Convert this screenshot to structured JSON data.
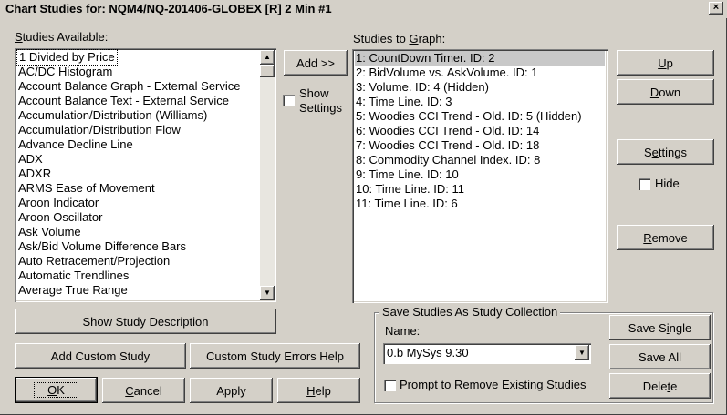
{
  "window": {
    "title": "Chart Studies for: NQM4/NQ-201406-GLOBEX [R]  2 Min  #1",
    "close_label": "×"
  },
  "available": {
    "label_prefix": "",
    "label_u": "S",
    "label_rest": "tudies Available:",
    "items": [
      "1 Divided by Price",
      "AC/DC Histogram",
      "Account Balance Graph - External Service",
      "Account Balance Text - External Service",
      "Accumulation/Distribution (Williams)",
      "Accumulation/Distribution Flow",
      "Advance Decline Line",
      "ADX",
      "ADXR",
      "ARMS Ease of Movement",
      "Aroon Indicator",
      "Aroon Oscillator",
      "Ask Volume",
      "Ask/Bid Volume Difference Bars",
      "Auto Retracement/Projection",
      "Automatic Trendlines",
      "Average True Range"
    ],
    "selected_index": 0
  },
  "add": {
    "label": "Add >>"
  },
  "show_settings": {
    "line1": "Show",
    "line2": "Settings",
    "checked": false
  },
  "to_graph": {
    "label_prefix": "Studies to ",
    "label_u": "G",
    "label_rest": "raph:",
    "items": [
      "1: CountDown Timer. ID: 2",
      "2: BidVolume vs. AskVolume. ID: 1",
      "3: Volume. ID: 4 (Hidden)",
      "4: Time Line. ID: 3",
      "5: Woodies CCI Trend - Old. ID: 5 (Hidden)",
      "6: Woodies CCI Trend - Old. ID: 14",
      "7: Woodies CCI Trend - Old. ID: 18",
      "8: Commodity Channel Index. ID: 8",
      "9: Time Line. ID: 10",
      "10: Time Line. ID: 11",
      "11: Time Line. ID: 6"
    ],
    "selected_index": 0
  },
  "right_buttons": {
    "up_u": "U",
    "up_rest": "p",
    "down_u": "D",
    "down_rest": "own",
    "settings_pre": "S",
    "settings_u": "e",
    "settings_rest": "ttings",
    "hide": "Hide",
    "remove_u": "R",
    "remove_rest": "emove"
  },
  "bottom": {
    "show_description": "Show Study Description",
    "add_custom": "Add Custom Study",
    "custom_errors": "Custom Study Errors Help",
    "ok_u": "O",
    "ok_rest": "K",
    "cancel_u": "C",
    "cancel_rest": "ancel",
    "apply": "Apply",
    "help_u": "H",
    "help_rest": "elp"
  },
  "collection": {
    "title": "Save Studies As Study Collection",
    "name_label": "Name:",
    "name_value": "0.b MySys 9.30",
    "prompt": "Prompt to Remove Existing Studies",
    "save_single_pre": "Save S",
    "save_single_u": "i",
    "save_single_rest": "ngle",
    "save_all": "Save All",
    "delete_pre": "Dele",
    "delete_u": "t",
    "delete_rest": "e"
  }
}
